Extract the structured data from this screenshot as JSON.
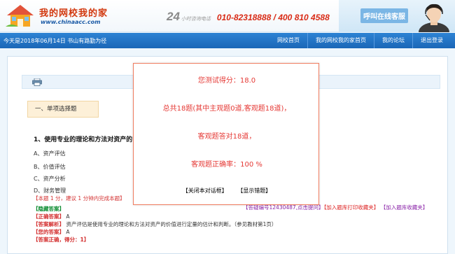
{
  "header": {
    "logo_name": "我的网校我的家",
    "logo_url": "www.chinaacc.com",
    "hotline_label": "小时咨询电话",
    "hotline_number": "24",
    "hotline_phones": "010-82318888 / 400 810 4588",
    "online_service": "呼叫在线客服"
  },
  "nav": {
    "date_text": "今天是2018年06月14日  书山有路勤为径",
    "items": [
      "网校首页",
      "我的网校我的家首页",
      "我的论坛",
      "退出登录"
    ]
  },
  "question": {
    "section_tab": "一、单项选择题",
    "title": "1、使用专业的理论和方法对资产的",
    "options": [
      "A、资产评估",
      "B、价值评估",
      "C、资产分析",
      "D、财务管理"
    ],
    "meta": "【本题 1 分，建议 1 分钟内完成本题】"
  },
  "links": {
    "question_id": "【答疑编号12430487,点击提问】",
    "add_print": "【加入题库打印收藏夹】",
    "add_error": "【加入题库收藏夹】"
  },
  "answers": {
    "hide_label": "【隐藏答案】",
    "correct_label": "【正确答案】",
    "correct_value": "A",
    "analysis_label": "【答案解析】",
    "analysis_text": "资产评估是使用专业的理论和方法对资产的价值进行定量的估计和判断。（参见教材第1页）",
    "your_label": "【您的答案】",
    "your_value": "A",
    "score_text": "【答案正确，得分：1】"
  },
  "modal": {
    "score": "您测试得分：18.0",
    "summary": "总共18题(其中主观题0道,客观题18道)，",
    "correct_count": "客观题答对18道，",
    "accuracy": "客观题正确率：100 %",
    "close_button": "【关闭本对话框】",
    "show_button": "【显示错题】"
  }
}
